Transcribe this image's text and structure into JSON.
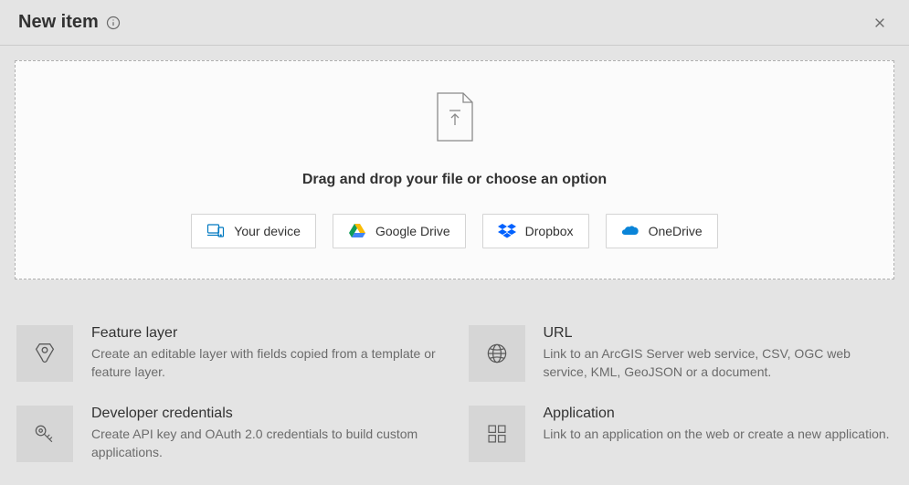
{
  "header": {
    "title": "New item"
  },
  "dropzone": {
    "instruction": "Drag and drop your file or choose an option",
    "sources": [
      {
        "label": "Your device"
      },
      {
        "label": "Google Drive"
      },
      {
        "label": "Dropbox"
      },
      {
        "label": "OneDrive"
      }
    ]
  },
  "options": [
    {
      "title": "Feature layer",
      "desc": "Create an editable layer with fields copied from a template or feature layer."
    },
    {
      "title": "URL",
      "desc": "Link to an ArcGIS Server web service, CSV, OGC web service, KML, GeoJSON or a document."
    },
    {
      "title": "Developer credentials",
      "desc": "Create API key and OAuth 2.0 credentials to build custom applications."
    },
    {
      "title": "Application",
      "desc": "Link to an application on the web or create a new application."
    }
  ]
}
